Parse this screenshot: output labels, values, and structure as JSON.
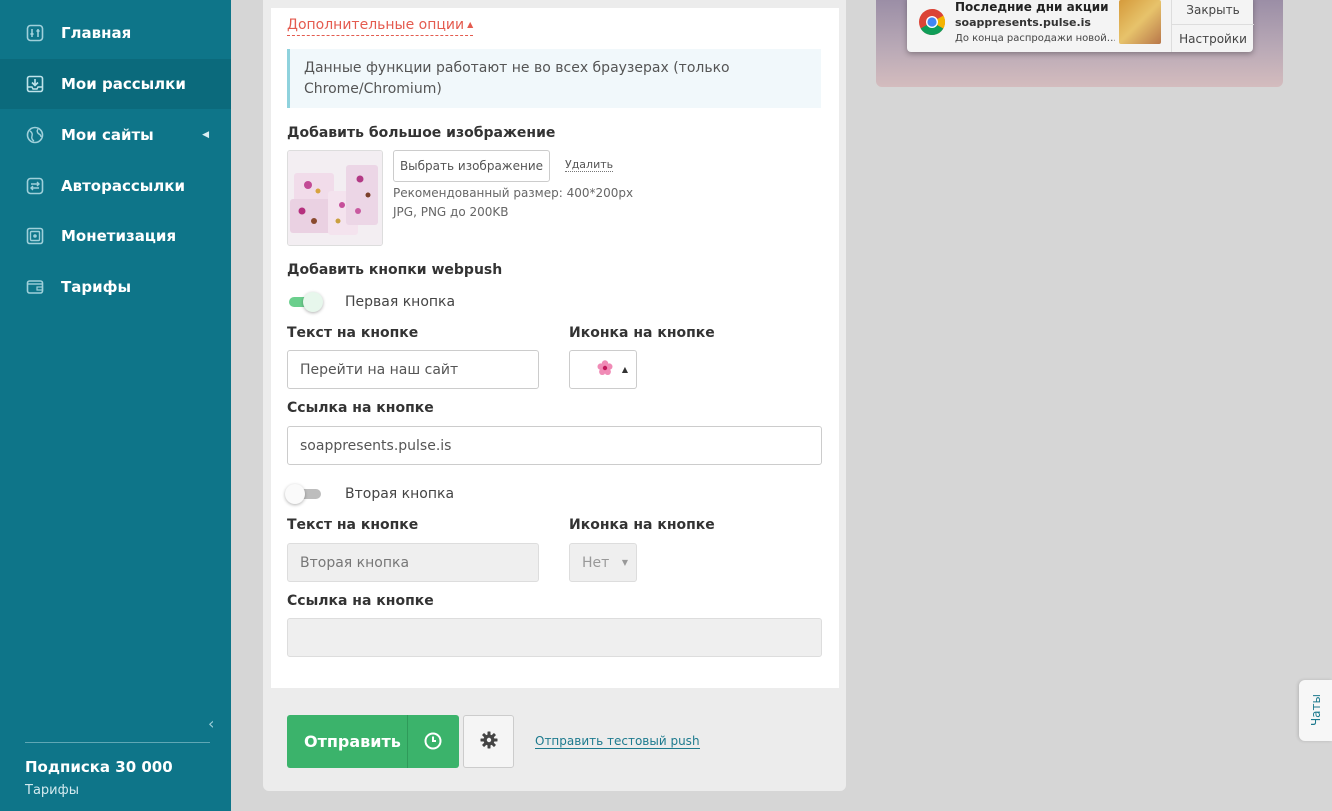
{
  "sidebar": {
    "items": [
      {
        "label": "Главная",
        "icon": "sliders-icon"
      },
      {
        "label": "Мои рассылки",
        "icon": "inbox-icon"
      },
      {
        "label": "Мои сайты",
        "icon": "globe-icon"
      },
      {
        "label": "Авторассылки",
        "icon": "auto-icon"
      },
      {
        "label": "Монетизация",
        "icon": "money-icon"
      },
      {
        "label": "Тарифы",
        "icon": "wallet-icon"
      }
    ],
    "subscription_title": "Подписка 30 000",
    "subscription_link": "Тарифы"
  },
  "options": {
    "toggle_label": "Дополнительные опции",
    "info_text": "Данные функции работают не во всех браузерах (только Chrome/Chromium)"
  },
  "image": {
    "heading": "Добавить большое изображение",
    "choose_button": "Выбрать изображение",
    "delete_link": "Удалить",
    "hint_size": "Рекомендованный размер: 400*200px",
    "hint_format": "JPG, PNG до 200KB"
  },
  "buttons": {
    "heading": "Добавить кнопки webpush",
    "first": {
      "toggle_label": "Первая кнопка",
      "enabled": true,
      "text_label": "Текст на кнопке",
      "text_value": "Перейти на наш сайт",
      "icon_label": "Иконка на кнопке",
      "link_label": "Ссылка на кнопке",
      "link_value": "soappresents.pulse.is"
    },
    "second": {
      "toggle_label": "Вторая кнопка",
      "enabled": false,
      "text_label": "Текст на кнопке",
      "text_value": "Вторая кнопка",
      "icon_label": "Иконка на кнопке",
      "icon_value": "Нет",
      "link_label": "Ссылка на кнопке",
      "link_value": ""
    }
  },
  "actions": {
    "send": "Отправить",
    "test_push": "Отправить тестовый push"
  },
  "preview": {
    "title": "Последние дни акции",
    "site": "soappresents.pulse.is",
    "body": "До конца распродажи новой…",
    "close": "Закрыть",
    "settings": "Настройки"
  },
  "chat": {
    "label": "Чаты"
  },
  "colors": {
    "sidebar": "#0e7589",
    "accent_red": "#e45b4f",
    "send_green": "#3bb36b"
  }
}
